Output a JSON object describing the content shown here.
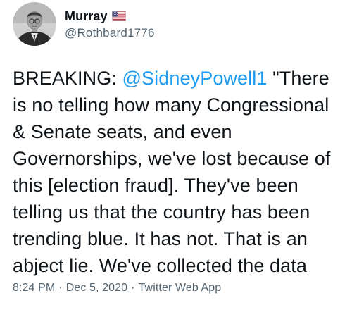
{
  "user": {
    "display_name": "Murray",
    "handle": "@Rothbard1776",
    "flag_icon": "us-flag-icon",
    "avatar_icon": "profile-photo"
  },
  "tweet": {
    "text_before_mention": "BREAKING: ",
    "mention": "@SidneyPowell1",
    "text_after_mention": " \"There is no telling how many Congressional & Senate seats, and even Governorships, we've lost because of this [election fraud]. They've been telling us that the country has been trending blue. It has not. That is an abject lie. We've collected the data"
  },
  "meta": {
    "time": "8:24 PM",
    "separator_1": "·",
    "date": "Dec 5, 2020",
    "separator_2": "·",
    "source": "Twitter Web App"
  },
  "colors": {
    "text": "#0f1419",
    "secondary": "#536471",
    "link": "#1d9bf0"
  }
}
